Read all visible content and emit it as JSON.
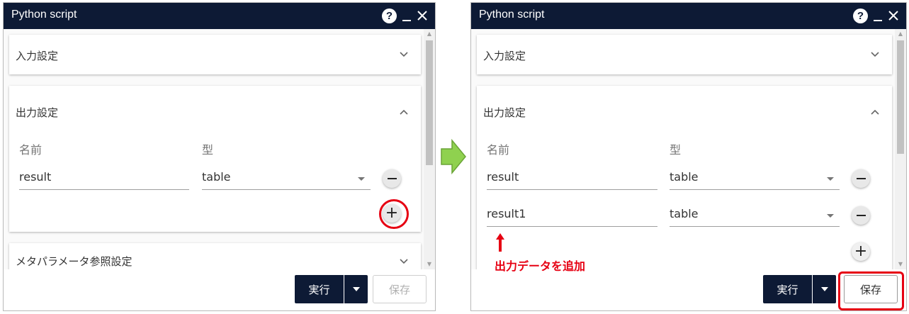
{
  "left": {
    "window_title": "Python script",
    "section_input": "入力設定",
    "section_output": "出力設定",
    "label_name": "名前",
    "label_type": "型",
    "rows": [
      {
        "name": "result",
        "type": "table"
      }
    ],
    "section_meta": "メタパラメータ参照設定",
    "run_label": "実行",
    "save_label": "保存"
  },
  "right": {
    "window_title": "Python script",
    "section_input": "入力設定",
    "section_output": "出力設定",
    "label_name": "名前",
    "label_type": "型",
    "rows": [
      {
        "name": "result",
        "type": "table"
      },
      {
        "name": "result1",
        "type": "table"
      }
    ],
    "annotation": "出力データを追加",
    "run_label": "実行",
    "save_label": "保存"
  },
  "colors": {
    "titlebar": "#0d1a35",
    "highlight": "#e60012",
    "arrow_fill": "#8fd14f"
  },
  "icons": [
    "help-icon",
    "minimize-icon",
    "close-icon",
    "chevron-down-icon",
    "chevron-up-icon",
    "minus-icon",
    "plus-icon",
    "dropdown-arrow-icon",
    "right-arrow-icon",
    "up-arrow-icon"
  ]
}
